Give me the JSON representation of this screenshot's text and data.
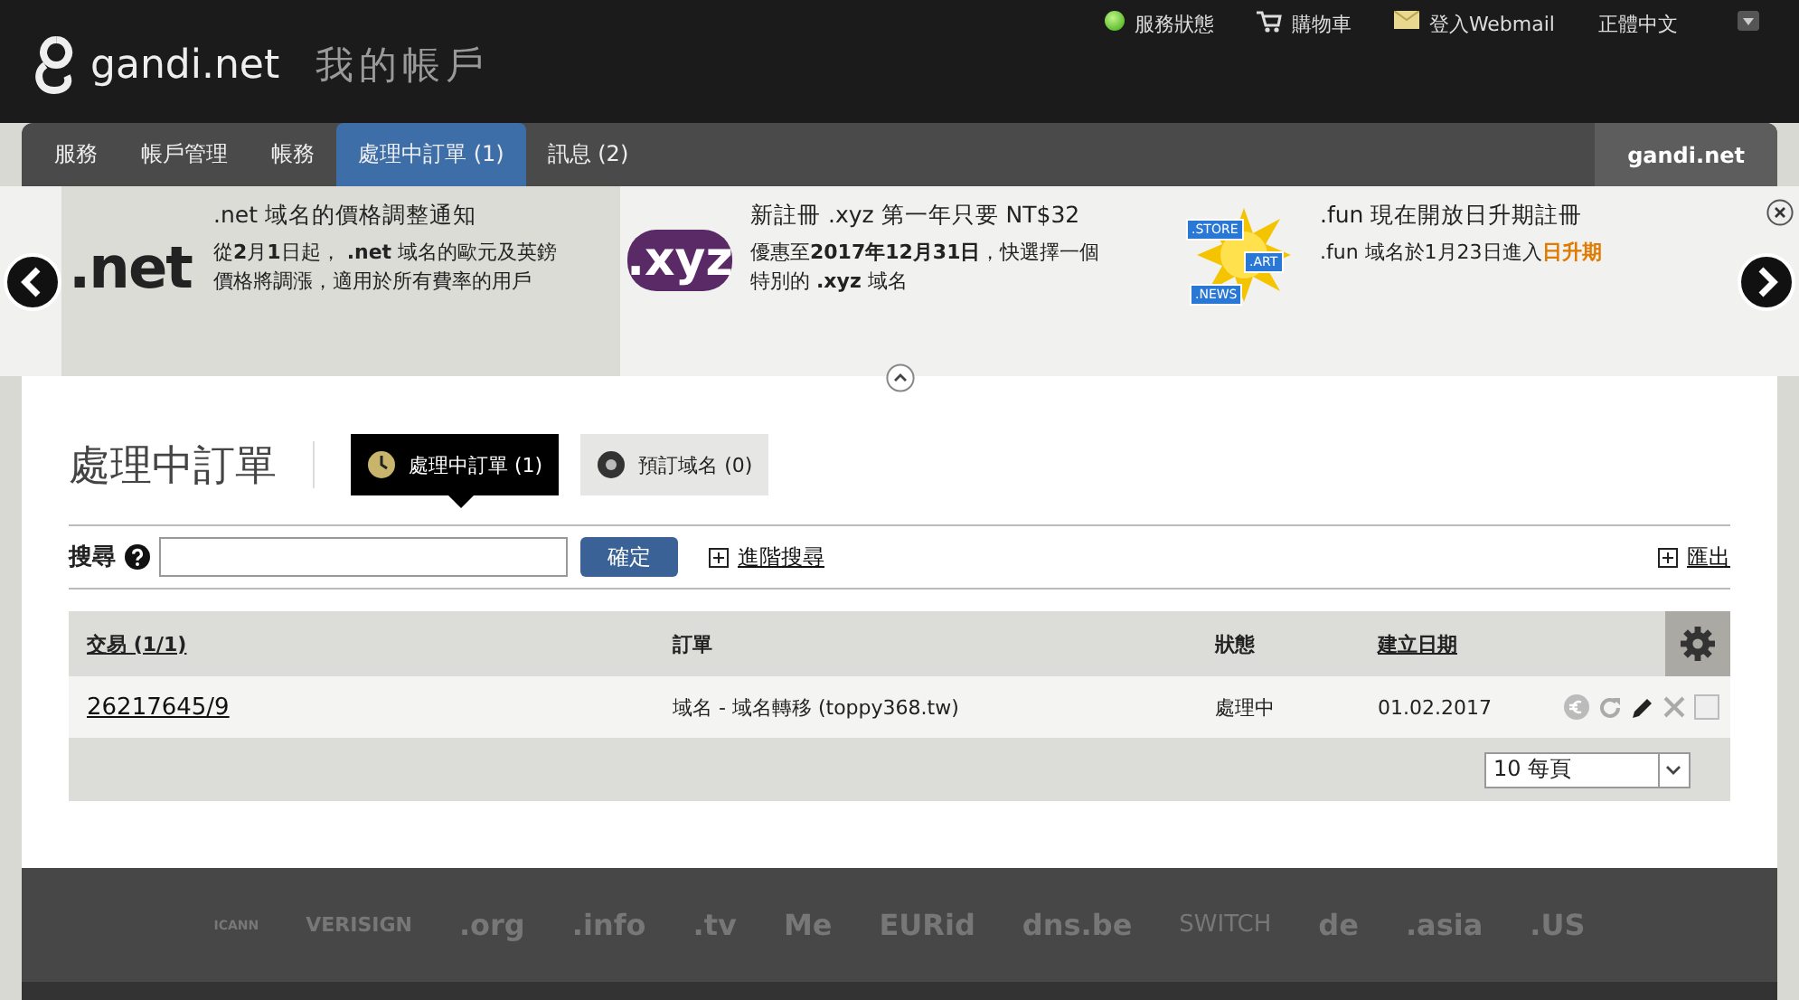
{
  "header": {
    "logo": "gandi.net",
    "subtitle": "我的帳戶",
    "links": [
      {
        "kind": "status",
        "label": "服務狀態"
      },
      {
        "kind": "cart",
        "label": "購物車"
      },
      {
        "kind": "mail",
        "label": "登入Webmail"
      },
      {
        "kind": "lang",
        "label": "正體中文"
      }
    ]
  },
  "nav": {
    "tabs": [
      {
        "label": "服務",
        "selected": false
      },
      {
        "label": "帳戶管理",
        "selected": false
      },
      {
        "label": "帳務",
        "selected": false
      },
      {
        "label": "處理中訂單 (1)",
        "selected": true
      },
      {
        "label": "訊息 (2)",
        "selected": false
      }
    ],
    "brand": "gandi.net"
  },
  "promos": [
    {
      "kind": "net",
      "logo": ".net",
      "title": ".net 域名的價格調整通知",
      "text": "從**2**月**1**日起， **.net** 域名的歐元及英鎊價格將調漲，適用於所有費率的用戶",
      "selected": true
    },
    {
      "kind": "xyz",
      "logo": ".xyz",
      "title": "新註冊 .xyz 第一年只要 NT$32",
      "text": "優惠至**2017年12月31日**，快選擇一個特別的 **.xyz** 域名",
      "selected": false
    },
    {
      "kind": "fun",
      "badges": [
        ".STORE",
        ".ART",
        ".NEWS"
      ],
      "title": ".fun 現在開放日升期註冊",
      "text": ".fun 域名於1月23日進入",
      "highlight": "日升期",
      "selected": false
    }
  ],
  "page": {
    "title": "處理中訂單",
    "subtabs": [
      {
        "kind": "clock",
        "label": "處理中訂單 (1)",
        "selected": true
      },
      {
        "kind": "disc",
        "label": "預訂域名 (0)",
        "selected": false
      }
    ]
  },
  "search": {
    "label": "搜尋",
    "button": "確定",
    "advanced": "進階搜尋",
    "export": "匯出"
  },
  "table": {
    "columns": [
      "交易 (1/1)",
      "訂單",
      "狀態",
      "建立日期"
    ],
    "rows": [
      {
        "id": "26217645/9",
        "order": "域名 - 域名轉移 (toppy368.tw)",
        "status": "處理中",
        "date": "01.02.2017",
        "checked": false
      }
    ],
    "page_size": "10 每頁"
  },
  "partners": [
    "ICANN",
    "VERISIGN",
    ".org",
    ".info",
    ".tv",
    "Me",
    "EURid",
    "dns.be",
    "SWITCH",
    "de",
    ".asia",
    ".US"
  ]
}
